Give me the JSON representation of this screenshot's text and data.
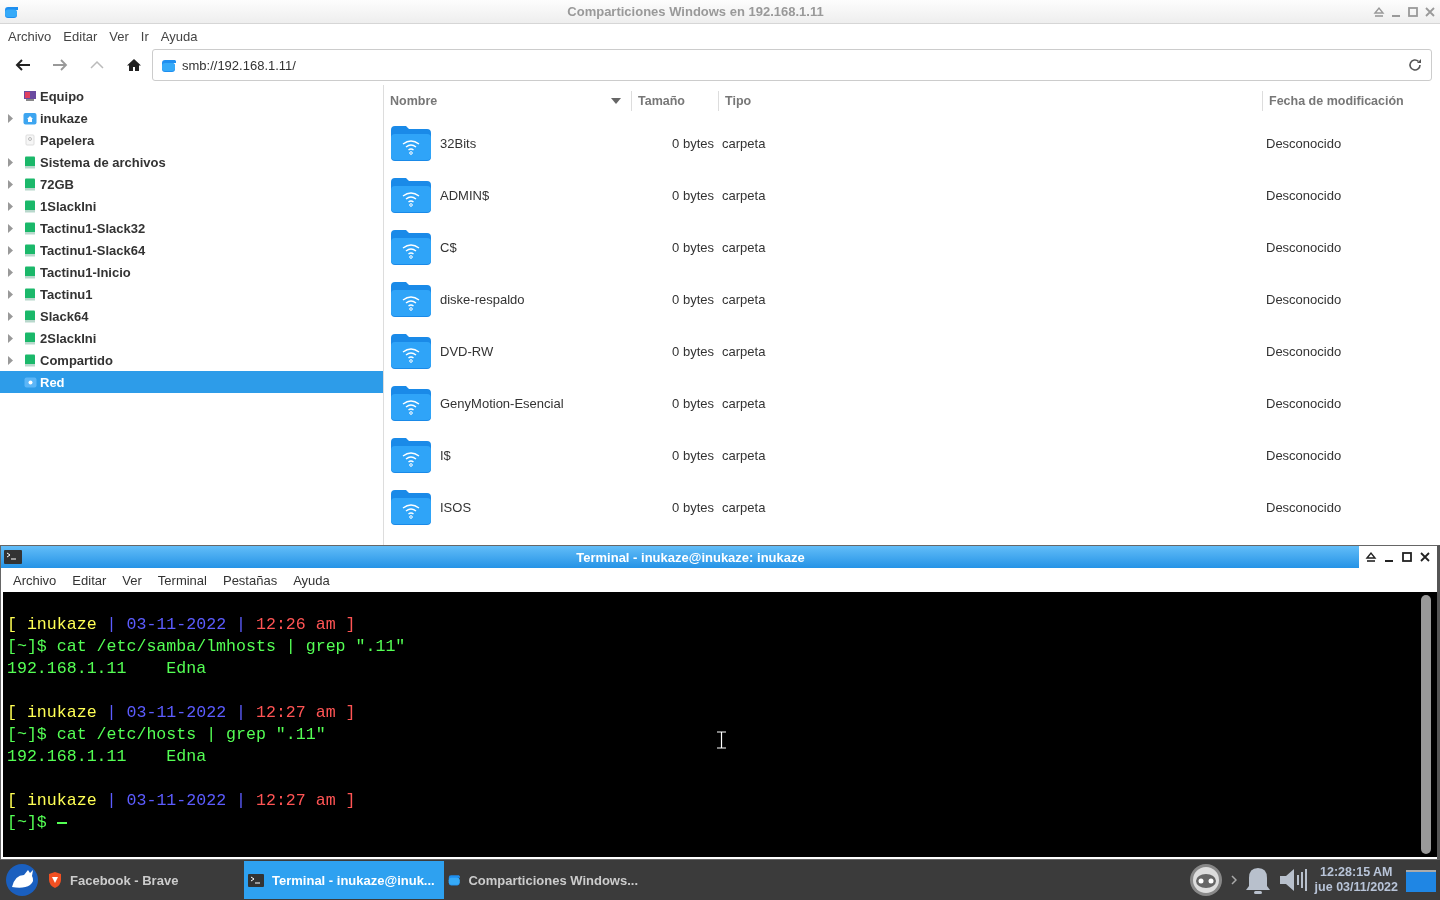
{
  "file_manager": {
    "title": "Comparticiones Windows en 192.168.1.11",
    "menu": [
      "Archivo",
      "Editar",
      "Ver",
      "Ir",
      "Ayuda"
    ],
    "location": "smb://192.168.1.11/",
    "sidebar": {
      "items": [
        {
          "label": "Equipo",
          "kind": "computer",
          "expandable": false,
          "selected": false
        },
        {
          "label": "inukaze",
          "kind": "home",
          "expandable": true,
          "selected": false
        },
        {
          "label": "Papelera",
          "kind": "trash",
          "expandable": false,
          "selected": false
        },
        {
          "label": "Sistema de archivos",
          "kind": "drive",
          "expandable": true,
          "selected": false
        },
        {
          "label": "72GB",
          "kind": "drive",
          "expandable": true,
          "selected": false
        },
        {
          "label": "1SlackIni",
          "kind": "drive",
          "expandable": true,
          "selected": false
        },
        {
          "label": "Tactinu1-Slack32",
          "kind": "drive",
          "expandable": true,
          "selected": false
        },
        {
          "label": "Tactinu1-Slack64",
          "kind": "drive",
          "expandable": true,
          "selected": false
        },
        {
          "label": "Tactinu1-Inicio",
          "kind": "drive",
          "expandable": true,
          "selected": false
        },
        {
          "label": "Tactinu1",
          "kind": "drive",
          "expandable": true,
          "selected": false
        },
        {
          "label": "Slack64",
          "kind": "drive",
          "expandable": true,
          "selected": false
        },
        {
          "label": "2SlackIni",
          "kind": "drive",
          "expandable": true,
          "selected": false
        },
        {
          "label": "Compartido",
          "kind": "drive",
          "expandable": true,
          "selected": false
        },
        {
          "label": "Red",
          "kind": "network",
          "expandable": false,
          "selected": true
        }
      ]
    },
    "file_list": {
      "columns": [
        {
          "label": "Nombre",
          "sorted": true
        },
        {
          "label": "Tamaño",
          "sorted": false
        },
        {
          "label": "Tipo",
          "sorted": false
        },
        {
          "label": "Fecha de modificación",
          "sorted": false
        }
      ],
      "rows": [
        {
          "name": "32Bits",
          "size": "0 bytes",
          "type": "carpeta",
          "modified": "Desconocido"
        },
        {
          "name": "ADMIN$",
          "size": "0 bytes",
          "type": "carpeta",
          "modified": "Desconocido"
        },
        {
          "name": "C$",
          "size": "0 bytes",
          "type": "carpeta",
          "modified": "Desconocido"
        },
        {
          "name": "diske-respaldo",
          "size": "0 bytes",
          "type": "carpeta",
          "modified": "Desconocido"
        },
        {
          "name": "DVD-RW",
          "size": "0 bytes",
          "type": "carpeta",
          "modified": "Desconocido"
        },
        {
          "name": "GenyMotion-Esencial",
          "size": "0 bytes",
          "type": "carpeta",
          "modified": "Desconocido"
        },
        {
          "name": "I$",
          "size": "0 bytes",
          "type": "carpeta",
          "modified": "Desconocido"
        },
        {
          "name": "ISOS",
          "size": "0 bytes",
          "type": "carpeta",
          "modified": "Desconocido"
        }
      ]
    }
  },
  "terminal": {
    "title": "Terminal - inukaze@inukaze: inukaze",
    "menu": [
      "Archivo",
      "Editar",
      "Ver",
      "Terminal",
      "Pestañas",
      "Ayuda"
    ],
    "lines": [
      {
        "kind": "blank"
      },
      {
        "kind": "text",
        "segments": [
          {
            "text": "[ inukaze ",
            "color": "#ffff54"
          },
          {
            "text": "| 03-11-2022 | ",
            "color": "#5c5cff"
          },
          {
            "text": "12:26 am ]",
            "color": "#ff5454"
          }
        ]
      },
      {
        "kind": "text",
        "segments": [
          {
            "text": "[~]$ cat /etc/samba/lmhosts | grep \".11\"",
            "color": "#54ff54"
          }
        ]
      },
      {
        "kind": "text",
        "segments": [
          {
            "text": "192.168.1.11    Edna",
            "color": "#54ff54"
          }
        ]
      },
      {
        "kind": "blank"
      },
      {
        "kind": "text",
        "segments": [
          {
            "text": "[ inukaze ",
            "color": "#ffff54"
          },
          {
            "text": "| 03-11-2022 | ",
            "color": "#5c5cff"
          },
          {
            "text": "12:27 am ]",
            "color": "#ff5454"
          }
        ]
      },
      {
        "kind": "text",
        "segments": [
          {
            "text": "[~]$ cat /etc/hosts | grep \".11\"",
            "color": "#54ff54"
          }
        ]
      },
      {
        "kind": "text",
        "segments": [
          {
            "text": "192.168.1.11    Edna",
            "color": "#54ff54"
          }
        ]
      },
      {
        "kind": "blank"
      },
      {
        "kind": "text",
        "segments": [
          {
            "text": "[ inukaze ",
            "color": "#ffff54"
          },
          {
            "text": "| 03-11-2022 | ",
            "color": "#5c5cff"
          },
          {
            "text": "12:27 am ]",
            "color": "#ff5454"
          }
        ]
      },
      {
        "kind": "input",
        "segments": [
          {
            "text": "[~]$ ",
            "color": "#54ff54"
          }
        ]
      }
    ]
  },
  "taskbar": {
    "tasks": [
      {
        "label": "Facebook - Brave",
        "kind": "browser",
        "selected": false
      },
      {
        "label": "Terminal - inukaze@inuk...",
        "kind": "terminal",
        "selected": true
      },
      {
        "label": "Comparticiones Windows...",
        "kind": "folder",
        "selected": false
      }
    ],
    "clock": {
      "time": "12:28:15 AM",
      "date": "jue 03/11/2022"
    }
  }
}
